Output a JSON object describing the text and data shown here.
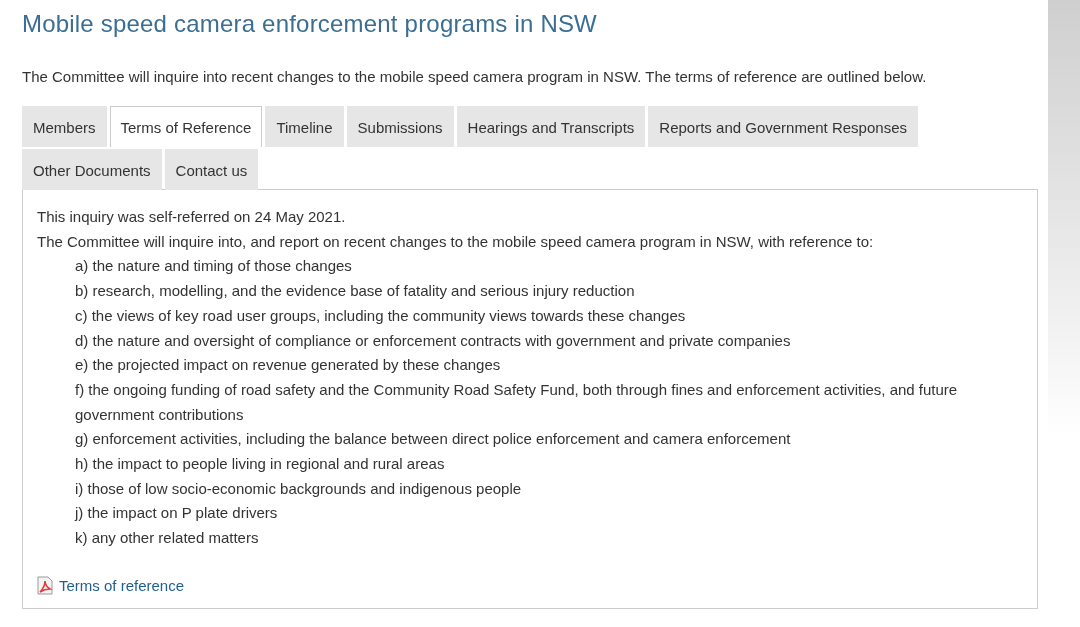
{
  "title": "Mobile speed camera enforcement programs in NSW",
  "intro": "The Committee will inquire into recent changes to the mobile speed camera program in NSW. The terms of reference are outlined below.",
  "tabs": [
    {
      "label": "Members",
      "selected": false
    },
    {
      "label": "Terms of Reference",
      "selected": true
    },
    {
      "label": "Timeline",
      "selected": false
    },
    {
      "label": "Submissions",
      "selected": false
    },
    {
      "label": "Hearings and Transcripts",
      "selected": false
    },
    {
      "label": "Reports and Government Responses",
      "selected": false
    },
    {
      "label": "Other Documents",
      "selected": false
    },
    {
      "label": "Contact us",
      "selected": false
    }
  ],
  "panel": {
    "paragraphs": [
      "This inquiry was self-referred on 24 May 2021.",
      "The Committee will inquire into, and report on recent changes to the mobile speed camera program in NSW, with reference to:"
    ],
    "items": [
      "a) the nature and timing of those changes",
      "b) research, modelling, and the evidence base of fatality and serious injury reduction",
      "c) the views of key road user groups, including the community views towards these changes",
      "d) the nature and oversight of compliance or enforcement contracts with government and private companies",
      "e) the projected impact on revenue generated by these changes",
      "f) the ongoing funding of road safety and the Community Road Safety Fund, both through fines and enforcement activities, and future government contributions",
      "g) enforcement activities, including the balance between direct police enforcement and camera enforcement",
      "h) the impact to people living in regional and rural areas",
      "i) those of low socio-economic backgrounds and indigenous people",
      "j) the impact on P plate drivers",
      "k) any other related matters"
    ],
    "link": "Terms of reference"
  }
}
